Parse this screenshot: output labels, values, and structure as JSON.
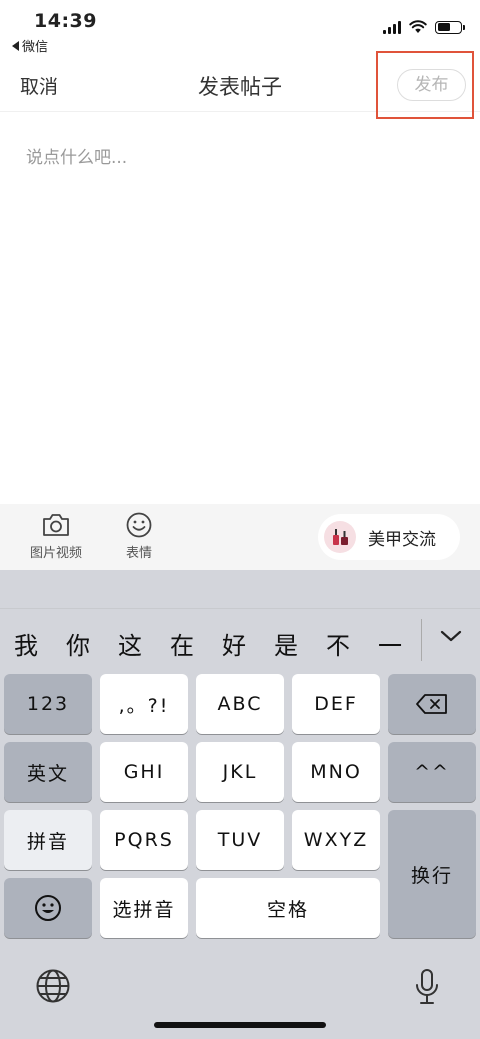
{
  "status_bar": {
    "time": "14:39",
    "back_app": "微信"
  },
  "nav": {
    "cancel": "取消",
    "title": "发表帖子",
    "publish": "发布"
  },
  "editor": {
    "placeholder": "说点什么吧..."
  },
  "toolbar": {
    "photo_video": "图片视频",
    "emoji": "表情",
    "tag": "美甲交流",
    "icons": {
      "photo": "camera-icon",
      "emoji": "smiley-icon"
    }
  },
  "keyboard": {
    "candidates": [
      "我",
      "你",
      "这",
      "在",
      "好",
      "是",
      "不",
      "一"
    ],
    "row1": [
      "123",
      ",。?!",
      "ABC",
      "DEF"
    ],
    "row2": [
      "英文",
      "GHI",
      "JKL",
      "MNO",
      "^^"
    ],
    "row3": [
      "拼音",
      "PQRS",
      "TUV",
      "WXYZ"
    ],
    "enter": "换行",
    "row4": [
      "选拼音",
      "空格"
    ],
    "icons": {
      "delete": "backspace-icon",
      "emoji": "emoji-icon",
      "globe": "globe-icon",
      "mic": "mic-icon",
      "collapse": "chevron-down-icon"
    }
  },
  "colors": {
    "highlight_box": "#e0533a",
    "keyboard_bg": "#d3d5db",
    "dark_key": "#adb2bc"
  }
}
